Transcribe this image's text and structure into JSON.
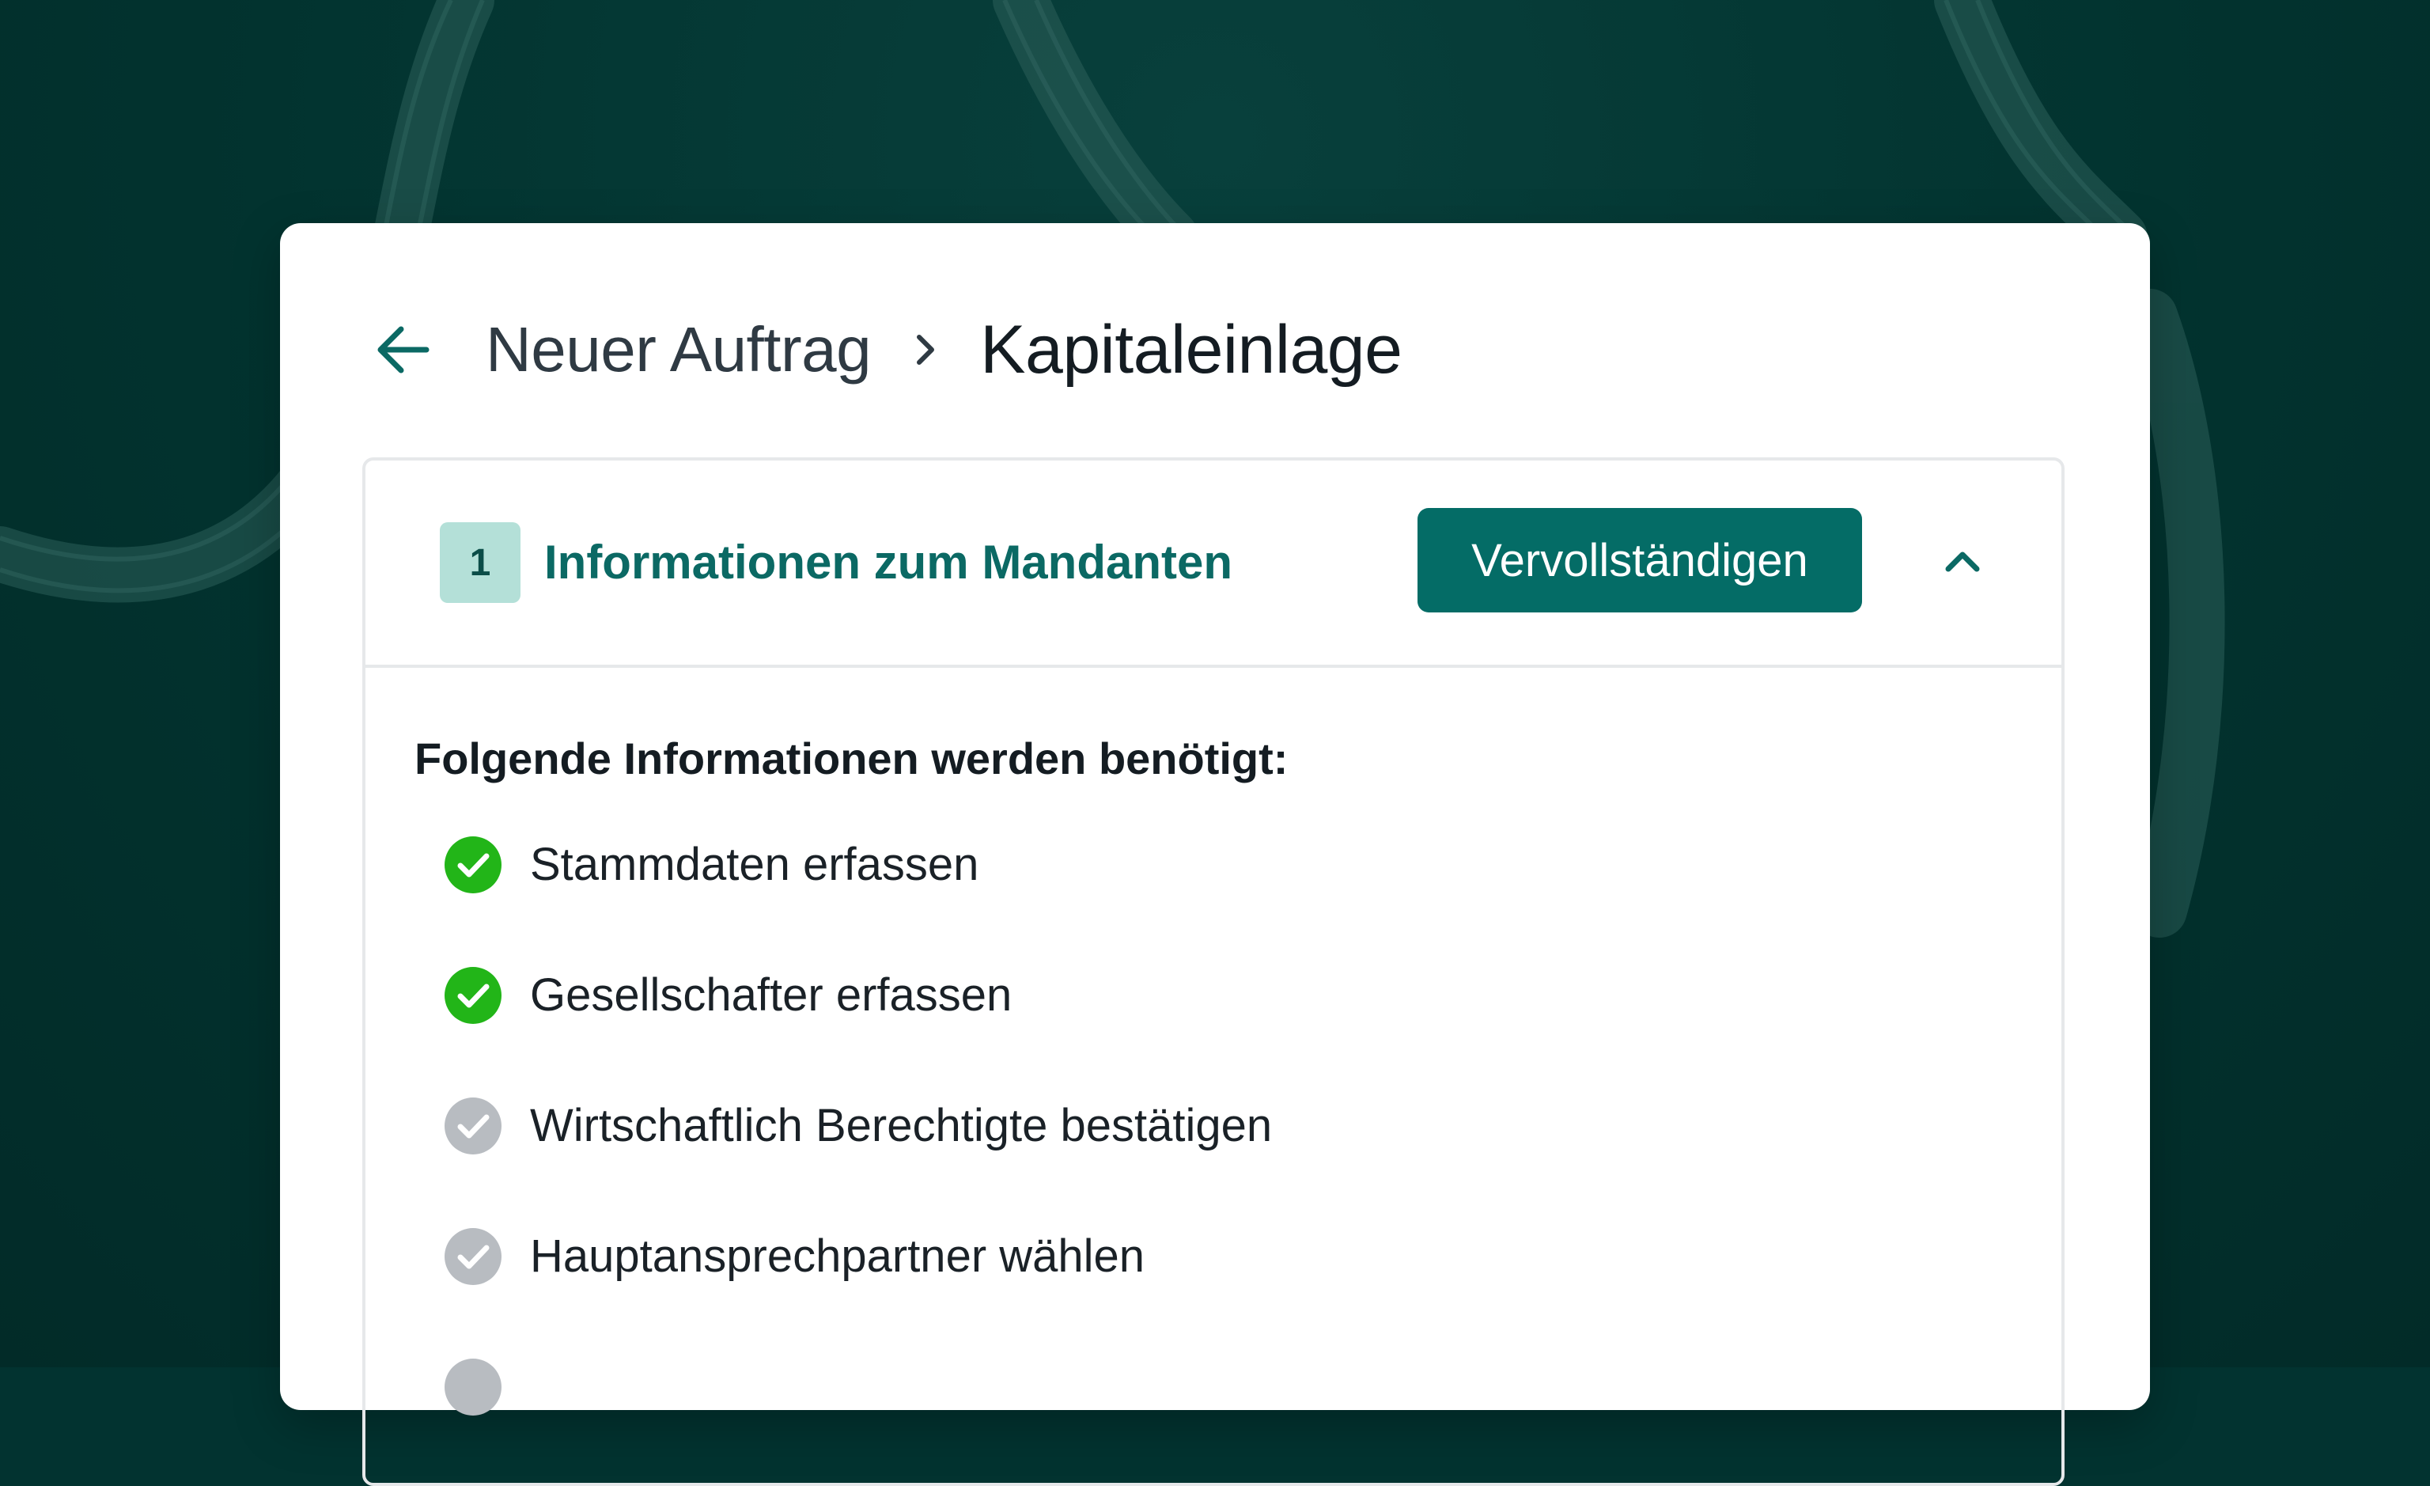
{
  "colors": {
    "background": "#023330",
    "accent": "#046c66",
    "accent_text": "#0b6964",
    "badge_bg": "#b4e0d8",
    "check_done": "#22b518",
    "check_pending": "#b8bcc1"
  },
  "header": {
    "back_icon": "arrow-left-icon",
    "breadcrumb_parent": "Neuer Auftrag",
    "separator_icon": "chevron-right-icon",
    "breadcrumb_current": "Kapitaleinlage"
  },
  "step": {
    "number": "1",
    "title": "Informationen zum Mandanten",
    "action_label": "Vervollständigen",
    "collapse_icon": "chevron-up-icon"
  },
  "requirements": {
    "heading": "Folgende Informationen werden benötigt:",
    "items": [
      {
        "label": "Stammdaten erfassen",
        "status": "done"
      },
      {
        "label": "Gesellschafter erfassen",
        "status": "done"
      },
      {
        "label": "Wirtschaftlich Berechtigte bestätigen",
        "status": "pending"
      },
      {
        "label": "Hauptansprechpartner wählen",
        "status": "pending"
      },
      {
        "label": "",
        "status": "pending"
      }
    ]
  }
}
